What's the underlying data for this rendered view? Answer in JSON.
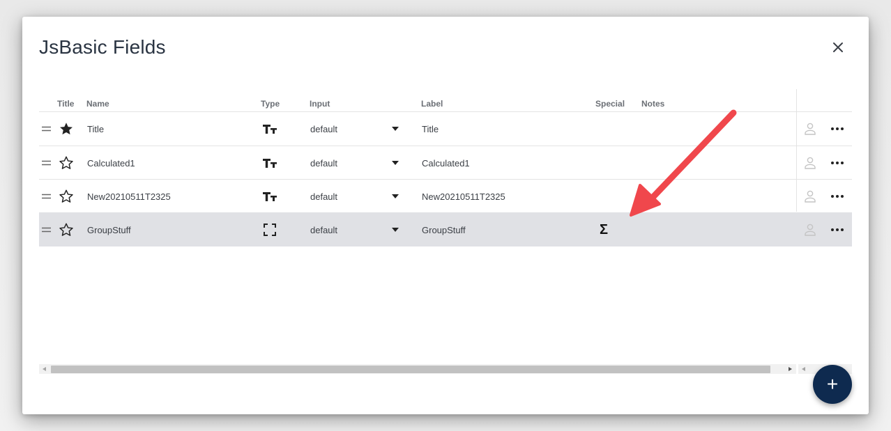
{
  "dialog": {
    "title": "JsBasic Fields",
    "close_icon": "close-icon"
  },
  "table": {
    "headers": {
      "title": "Title",
      "name": "Name",
      "type": "Type",
      "input": "Input",
      "label": "Label",
      "special": "Special",
      "notes": "Notes"
    },
    "rows": [
      {
        "starred": true,
        "name": "Title",
        "type_icon": "text-type-icon",
        "input": "default",
        "label": "Title",
        "special": ""
      },
      {
        "starred": false,
        "name": "Calculated1",
        "type_icon": "text-type-icon",
        "input": "default",
        "label": "Calculated1",
        "special": ""
      },
      {
        "starred": false,
        "name": "New20210511T2325",
        "type_icon": "text-type-icon",
        "input": "default",
        "label": "New20210511T2325",
        "special": ""
      },
      {
        "starred": false,
        "name": "GroupStuff",
        "type_icon": "group-type-icon",
        "input": "default",
        "label": "GroupStuff",
        "special": "Σ",
        "selected": true
      }
    ]
  },
  "fab": {
    "label": "+"
  },
  "colors": {
    "accent": "#0e2a4f",
    "annotation_arrow": "#f0474c",
    "selected_row": "#e0e1e5"
  }
}
